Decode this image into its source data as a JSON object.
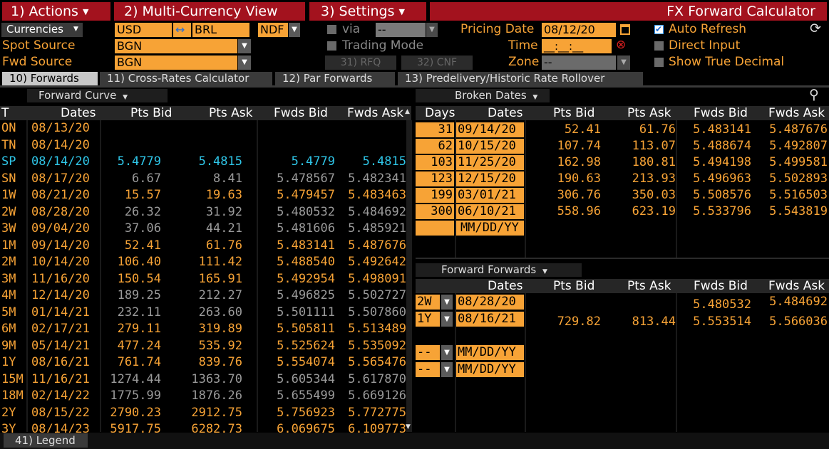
{
  "menu": {
    "actions": "1) Actions",
    "multi_currency": "2) Multi-Currency View",
    "settings": "3) Settings",
    "title": "FX Forward Calculator"
  },
  "controls": {
    "currencies_label": "Currencies",
    "ccy1": "USD",
    "ccy_swap": "↔",
    "ccy2": "BRL",
    "ndf": "NDF",
    "via_label": "via",
    "via_value": "--",
    "pricing_date_label": "Pricing Date",
    "pricing_date": "08/12/20",
    "auto_refresh": "Auto Refresh",
    "spot_source_label": "Spot Source",
    "spot_source": "BGN",
    "trading_mode": "Trading Mode",
    "time_label": "Time",
    "time_value": "__:__:__",
    "direct_input": "Direct Input",
    "fwd_source_label": "Fwd Source",
    "fwd_source": "BGN",
    "rfq": "31) RFQ",
    "cnf": "32) CNF",
    "zone_label": "Zone",
    "zone_value": "--",
    "show_true_decimal": "Show True Decimal"
  },
  "tabs": [
    {
      "label": "10) Forwards"
    },
    {
      "label": "11) Cross-Rates Calculator"
    },
    {
      "label": "12) Par Forwards"
    },
    {
      "label": "13) Predelivery/Historic Rate Rollover"
    }
  ],
  "forward_curve": {
    "title": "Forward Curve",
    "headers": [
      "T",
      "Dates",
      "Pts Bid",
      "Pts Ask",
      "Fwds Bid",
      "Fwds Ask"
    ],
    "rows": [
      {
        "t": "ON",
        "date": "08/13/20",
        "pb": "",
        "pa": "",
        "fb": "",
        "fa": "",
        "style": "o"
      },
      {
        "t": "TN",
        "date": "08/14/20",
        "pb": "",
        "pa": "",
        "fb": "",
        "fa": "",
        "style": "o"
      },
      {
        "t": "SP",
        "date": "08/14/20",
        "pb": "5.4779",
        "pa": "5.4815",
        "fb": "5.4779",
        "fa": "5.4815",
        "style": "c"
      },
      {
        "t": "SN",
        "date": "08/17/20",
        "pb": "6.67",
        "pa": "8.41",
        "fb": "5.478567",
        "fa": "5.482341",
        "style": "g"
      },
      {
        "t": "1W",
        "date": "08/21/20",
        "pb": "15.57",
        "pa": "19.63",
        "fb": "5.479457",
        "fa": "5.483463",
        "style": "o"
      },
      {
        "t": "2W",
        "date": "08/28/20",
        "pb": "26.32",
        "pa": "31.92",
        "fb": "5.480532",
        "fa": "5.484692",
        "style": "g"
      },
      {
        "t": "3W",
        "date": "09/04/20",
        "pb": "37.06",
        "pa": "44.21",
        "fb": "5.481606",
        "fa": "5.485921",
        "style": "g"
      },
      {
        "t": "1M",
        "date": "09/14/20",
        "pb": "52.41",
        "pa": "61.76",
        "fb": "5.483141",
        "fa": "5.487676",
        "style": "o"
      },
      {
        "t": "2M",
        "date": "10/14/20",
        "pb": "106.40",
        "pa": "111.42",
        "fb": "5.488540",
        "fa": "5.492642",
        "style": "o"
      },
      {
        "t": "3M",
        "date": "11/16/20",
        "pb": "150.54",
        "pa": "165.91",
        "fb": "5.492954",
        "fa": "5.498091",
        "style": "o"
      },
      {
        "t": "4M",
        "date": "12/14/20",
        "pb": "189.25",
        "pa": "212.27",
        "fb": "5.496825",
        "fa": "5.502727",
        "style": "g"
      },
      {
        "t": "5M",
        "date": "01/14/21",
        "pb": "232.11",
        "pa": "263.60",
        "fb": "5.501111",
        "fa": "5.507860",
        "style": "g"
      },
      {
        "t": "6M",
        "date": "02/17/21",
        "pb": "279.11",
        "pa": "319.89",
        "fb": "5.505811",
        "fa": "5.513489",
        "style": "o"
      },
      {
        "t": "9M",
        "date": "05/14/21",
        "pb": "477.24",
        "pa": "535.92",
        "fb": "5.525624",
        "fa": "5.535092",
        "style": "o"
      },
      {
        "t": "1Y",
        "date": "08/16/21",
        "pb": "761.74",
        "pa": "839.76",
        "fb": "5.554074",
        "fa": "5.565476",
        "style": "o"
      },
      {
        "t": "15M",
        "date": "11/16/21",
        "pb": "1274.44",
        "pa": "1363.70",
        "fb": "5.605344",
        "fa": "5.617870",
        "style": "g"
      },
      {
        "t": "18M",
        "date": "02/14/22",
        "pb": "1775.99",
        "pa": "1876.26",
        "fb": "5.655499",
        "fa": "5.669126",
        "style": "g"
      },
      {
        "t": "2Y",
        "date": "08/15/22",
        "pb": "2790.23",
        "pa": "2912.75",
        "fb": "5.756923",
        "fa": "5.772775",
        "style": "o"
      },
      {
        "t": "3Y",
        "date": "08/14/23",
        "pb": "5917.75",
        "pa": "6282.73",
        "fb": "6.069675",
        "fa": "6.109773",
        "style": "o"
      }
    ]
  },
  "broken_dates": {
    "title": "Broken Dates",
    "headers": [
      "Days",
      "Dates",
      "Pts Bid",
      "Pts Ask",
      "Fwds Bid",
      "Fwds Ask"
    ],
    "rows": [
      {
        "days": "31",
        "date": "09/14/20",
        "pb": "52.41",
        "pa": "61.76",
        "fb": "5.483141",
        "fa": "5.487676"
      },
      {
        "days": "62",
        "date": "10/15/20",
        "pb": "107.74",
        "pa": "113.07",
        "fb": "5.488674",
        "fa": "5.492807"
      },
      {
        "days": "103",
        "date": "11/25/20",
        "pb": "162.98",
        "pa": "180.81",
        "fb": "5.494198",
        "fa": "5.499581"
      },
      {
        "days": "123",
        "date": "12/15/20",
        "pb": "190.63",
        "pa": "213.93",
        "fb": "5.496963",
        "fa": "5.502893"
      },
      {
        "days": "199",
        "date": "03/01/21",
        "pb": "306.76",
        "pa": "350.03",
        "fb": "5.508576",
        "fa": "5.516503"
      },
      {
        "days": "300",
        "date": "06/10/21",
        "pb": "558.96",
        "pa": "623.19",
        "fb": "5.533796",
        "fa": "5.543819"
      }
    ],
    "placeholder": "MM/DD/YY"
  },
  "forward_forwards": {
    "title": "Forward Forwards",
    "headers": [
      "Dates",
      "Pts Bid",
      "Pts Ask",
      "Fwds Bid",
      "Fwds Ask"
    ],
    "rows": [
      {
        "tenor": "2W",
        "date": "08/28/20",
        "pb": "",
        "pa": "",
        "fb": "5.480532",
        "fa": "5.484692"
      },
      {
        "tenor": "1Y",
        "date": "08/16/21",
        "pb": "729.82",
        "pa": "813.44",
        "fb": "5.553514",
        "fa": "5.566036"
      },
      {
        "tenor": "--",
        "date": "MM/DD/YY",
        "pb": "",
        "pa": "",
        "fb": "",
        "fa": ""
      },
      {
        "tenor": "--",
        "date": "MM/DD/YY",
        "pb": "",
        "pa": "",
        "fb": "",
        "fa": ""
      }
    ]
  },
  "footer": {
    "legend": "41) Legend"
  },
  "colors": {
    "orange": "#f7a336",
    "cyan": "#2fc6e8",
    "gray": "#9a9a9a",
    "menu_red": "#a3121e"
  }
}
